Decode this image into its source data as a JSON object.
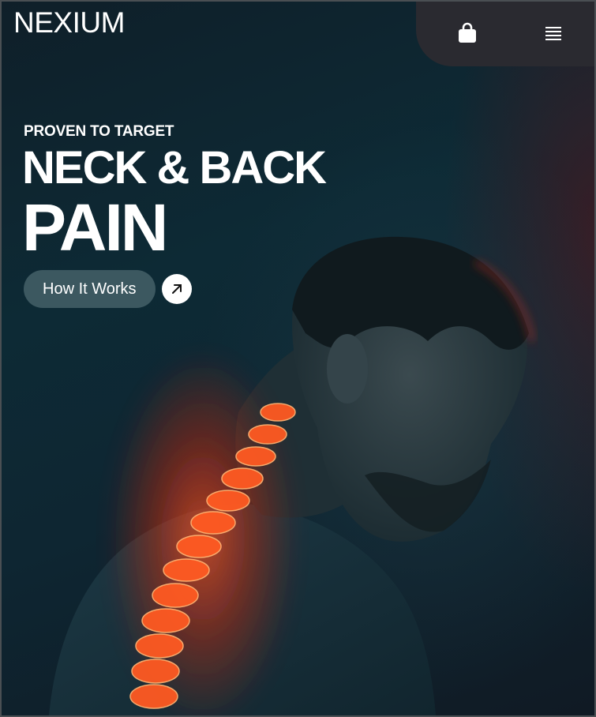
{
  "header": {
    "brand": "NEXIUM",
    "cart_icon": "shopping-bag-icon",
    "menu_icon": "hamburger-menu-icon"
  },
  "hero": {
    "eyebrow": "PROVEN TO TARGET",
    "headline_line1": "NECK & BACK",
    "headline_line2": "PAIN",
    "cta_label": "How It Works",
    "cta_icon": "arrow-up-right-icon",
    "image_subject": "man-with-glowing-spine"
  },
  "colors": {
    "background": "#0e2632",
    "nav_panel": "#2a2a30",
    "cta_pill": "#3c5860",
    "spine_glow": "#ff4a1c",
    "text": "#ffffff"
  }
}
